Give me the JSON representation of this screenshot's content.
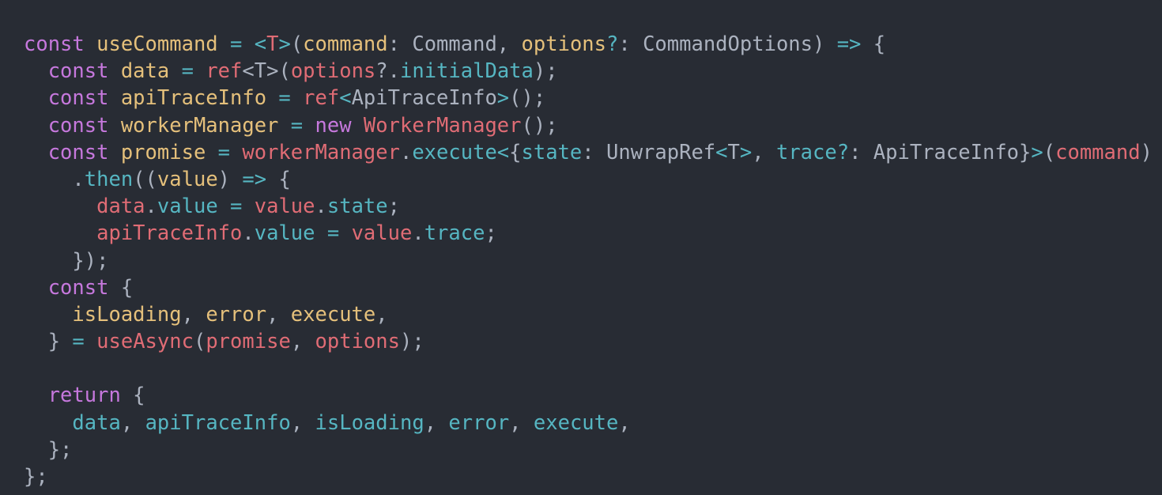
{
  "code": {
    "language": "typescript",
    "lines": [
      [
        {
          "t": "const ",
          "c": "kw"
        },
        {
          "t": "useCommand",
          "c": "def"
        },
        {
          "t": " ",
          "c": "plain"
        },
        {
          "t": "=",
          "c": "op"
        },
        {
          "t": " ",
          "c": "plain"
        },
        {
          "t": "<",
          "c": "op"
        },
        {
          "t": "T",
          "c": "ty"
        },
        {
          "t": ">",
          "c": "op"
        },
        {
          "t": "(",
          "c": "plain"
        },
        {
          "t": "command",
          "c": "def"
        },
        {
          "t": ": Command, ",
          "c": "plain"
        },
        {
          "t": "options",
          "c": "def"
        },
        {
          "t": "?",
          "c": "op"
        },
        {
          "t": ": CommandOptions) ",
          "c": "plain"
        },
        {
          "t": "=>",
          "c": "op"
        },
        {
          "t": " {",
          "c": "plain"
        }
      ],
      [
        {
          "t": "  const ",
          "c": "kw"
        },
        {
          "t": "data",
          "c": "def"
        },
        {
          "t": " ",
          "c": "plain"
        },
        {
          "t": "=",
          "c": "op"
        },
        {
          "t": " ",
          "c": "plain"
        },
        {
          "t": "ref",
          "c": "fn"
        },
        {
          "t": "<T>(",
          "c": "plain"
        },
        {
          "t": "options",
          "c": "var"
        },
        {
          "t": "?.",
          "c": "plain"
        },
        {
          "t": "initialData",
          "c": "prop"
        },
        {
          "t": ");",
          "c": "plain"
        }
      ],
      [
        {
          "t": "  const ",
          "c": "kw"
        },
        {
          "t": "apiTraceInfo",
          "c": "def"
        },
        {
          "t": " ",
          "c": "plain"
        },
        {
          "t": "=",
          "c": "op"
        },
        {
          "t": " ",
          "c": "plain"
        },
        {
          "t": "ref",
          "c": "fn"
        },
        {
          "t": "<",
          "c": "op"
        },
        {
          "t": "ApiTraceInfo",
          "c": "plain"
        },
        {
          "t": ">",
          "c": "op"
        },
        {
          "t": "();",
          "c": "plain"
        }
      ],
      [
        {
          "t": "  const ",
          "c": "kw"
        },
        {
          "t": "workerManager",
          "c": "def"
        },
        {
          "t": " ",
          "c": "plain"
        },
        {
          "t": "=",
          "c": "op"
        },
        {
          "t": " ",
          "c": "plain"
        },
        {
          "t": "new ",
          "c": "kw"
        },
        {
          "t": "WorkerManager",
          "c": "fn"
        },
        {
          "t": "();",
          "c": "plain"
        }
      ],
      [
        {
          "t": "  const ",
          "c": "kw"
        },
        {
          "t": "promise",
          "c": "def"
        },
        {
          "t": " ",
          "c": "plain"
        },
        {
          "t": "=",
          "c": "op"
        },
        {
          "t": " ",
          "c": "plain"
        },
        {
          "t": "workerManager",
          "c": "var"
        },
        {
          "t": ".",
          "c": "plain"
        },
        {
          "t": "execute",
          "c": "prop"
        },
        {
          "t": "<",
          "c": "op"
        },
        {
          "t": "{",
          "c": "plain"
        },
        {
          "t": "state",
          "c": "attr"
        },
        {
          "t": ": UnwrapRef",
          "c": "plain"
        },
        {
          "t": "<",
          "c": "op"
        },
        {
          "t": "T",
          "c": "plain"
        },
        {
          "t": ">",
          "c": "op"
        },
        {
          "t": ", ",
          "c": "plain"
        },
        {
          "t": "trace",
          "c": "attr"
        },
        {
          "t": "?",
          "c": "op"
        },
        {
          "t": ": ApiTraceInfo}",
          "c": "plain"
        },
        {
          "t": ">",
          "c": "op"
        },
        {
          "t": "(",
          "c": "plain"
        },
        {
          "t": "command",
          "c": "var"
        },
        {
          "t": ")",
          "c": "plain"
        }
      ],
      [
        {
          "t": "    .",
          "c": "plain"
        },
        {
          "t": "then",
          "c": "prop"
        },
        {
          "t": "((",
          "c": "plain"
        },
        {
          "t": "value",
          "c": "def"
        },
        {
          "t": ") ",
          "c": "plain"
        },
        {
          "t": "=>",
          "c": "op"
        },
        {
          "t": " {",
          "c": "plain"
        }
      ],
      [
        {
          "t": "      ",
          "c": "plain"
        },
        {
          "t": "data",
          "c": "var"
        },
        {
          "t": ".",
          "c": "plain"
        },
        {
          "t": "value",
          "c": "prop"
        },
        {
          "t": " ",
          "c": "plain"
        },
        {
          "t": "=",
          "c": "op"
        },
        {
          "t": " ",
          "c": "plain"
        },
        {
          "t": "value",
          "c": "var"
        },
        {
          "t": ".",
          "c": "plain"
        },
        {
          "t": "state",
          "c": "prop"
        },
        {
          "t": ";",
          "c": "plain"
        }
      ],
      [
        {
          "t": "      ",
          "c": "plain"
        },
        {
          "t": "apiTraceInfo",
          "c": "var"
        },
        {
          "t": ".",
          "c": "plain"
        },
        {
          "t": "value",
          "c": "prop"
        },
        {
          "t": " ",
          "c": "plain"
        },
        {
          "t": "=",
          "c": "op"
        },
        {
          "t": " ",
          "c": "plain"
        },
        {
          "t": "value",
          "c": "var"
        },
        {
          "t": ".",
          "c": "plain"
        },
        {
          "t": "trace",
          "c": "prop"
        },
        {
          "t": ";",
          "c": "plain"
        }
      ],
      [
        {
          "t": "    });",
          "c": "plain"
        }
      ],
      [
        {
          "t": "  const ",
          "c": "kw"
        },
        {
          "t": "{",
          "c": "plain"
        }
      ],
      [
        {
          "t": "    ",
          "c": "plain"
        },
        {
          "t": "isLoading",
          "c": "def"
        },
        {
          "t": ", ",
          "c": "plain"
        },
        {
          "t": "error",
          "c": "def"
        },
        {
          "t": ", ",
          "c": "plain"
        },
        {
          "t": "execute",
          "c": "def"
        },
        {
          "t": ",",
          "c": "plain"
        }
      ],
      [
        {
          "t": "  } ",
          "c": "plain"
        },
        {
          "t": "=",
          "c": "op"
        },
        {
          "t": " ",
          "c": "plain"
        },
        {
          "t": "useAsync",
          "c": "fn"
        },
        {
          "t": "(",
          "c": "plain"
        },
        {
          "t": "promise",
          "c": "var"
        },
        {
          "t": ", ",
          "c": "plain"
        },
        {
          "t": "options",
          "c": "var"
        },
        {
          "t": ");",
          "c": "plain"
        }
      ],
      [],
      [
        {
          "t": "  return ",
          "c": "kw"
        },
        {
          "t": "{",
          "c": "plain"
        }
      ],
      [
        {
          "t": "    ",
          "c": "plain"
        },
        {
          "t": "data",
          "c": "attr"
        },
        {
          "t": ", ",
          "c": "plain"
        },
        {
          "t": "apiTraceInfo",
          "c": "attr"
        },
        {
          "t": ", ",
          "c": "plain"
        },
        {
          "t": "isLoading",
          "c": "attr"
        },
        {
          "t": ", ",
          "c": "plain"
        },
        {
          "t": "error",
          "c": "attr"
        },
        {
          "t": ", ",
          "c": "plain"
        },
        {
          "t": "execute",
          "c": "attr"
        },
        {
          "t": ",",
          "c": "plain"
        }
      ],
      [
        {
          "t": "  };",
          "c": "plain"
        }
      ],
      [
        {
          "t": "};",
          "c": "plain"
        }
      ]
    ]
  },
  "colors": {
    "background": "#282c34",
    "keyword": "#c678dd",
    "definition": "#e5c07b",
    "operator": "#56b6c2",
    "function_or_variable": "#e06c75",
    "plain": "#abb2bf"
  }
}
